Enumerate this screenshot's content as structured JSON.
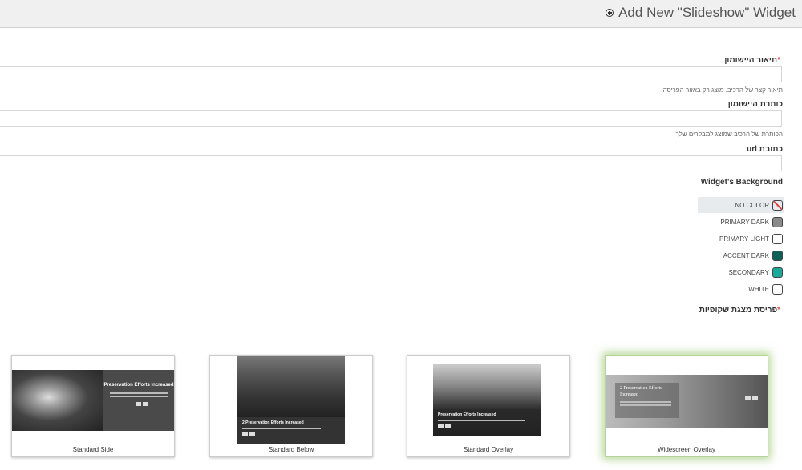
{
  "header": {
    "title": "Add New \"Slideshow\" Widget",
    "icon": "plus-circle-icon"
  },
  "form": {
    "description": {
      "label": "תיאור היישומון",
      "required_mark": "*",
      "value": "",
      "help": "תיאור קצר של הרכיב. מוצג רק באזור הפריסה."
    },
    "title": {
      "label": "כותרת היישומון",
      "value": "",
      "help": "הכותרת של הרכיב שמוצג למבקרים שלך"
    },
    "url": {
      "label": "כתובת url",
      "value": ""
    }
  },
  "background": {
    "label": "Widget's Background",
    "options": [
      {
        "label": "NO COLOR",
        "color": "#ffffff",
        "selected": true
      },
      {
        "label": "PRIMARY DARK",
        "color": "#8a8a8a",
        "selected": false
      },
      {
        "label": "PRIMARY LIGHT",
        "color": "#ffffff",
        "selected": false
      },
      {
        "label": "ACCENT DARK",
        "color": "#0e5f57",
        "selected": false
      },
      {
        "label": "SECONDARY",
        "color": "#1aa999",
        "selected": false
      },
      {
        "label": "WHITE",
        "color": "#ffffff",
        "selected": false
      }
    ]
  },
  "layout": {
    "label": "פריסת מצגת שקופיות",
    "required_mark": "*",
    "options": [
      {
        "caption": "Standard Side",
        "thumb_title": "Preservation Efforts Increased",
        "selected": false
      },
      {
        "caption": "Standard Below",
        "thumb_title": "2 Preservation Efforts Increased",
        "selected": false
      },
      {
        "caption": "Standard Overlay",
        "thumb_title": "Preservation Efforts Increased",
        "selected": false
      },
      {
        "caption": "Widescreen Overlay",
        "thumb_title": "2 Preservation Efforts Increased",
        "selected": true
      }
    ]
  }
}
